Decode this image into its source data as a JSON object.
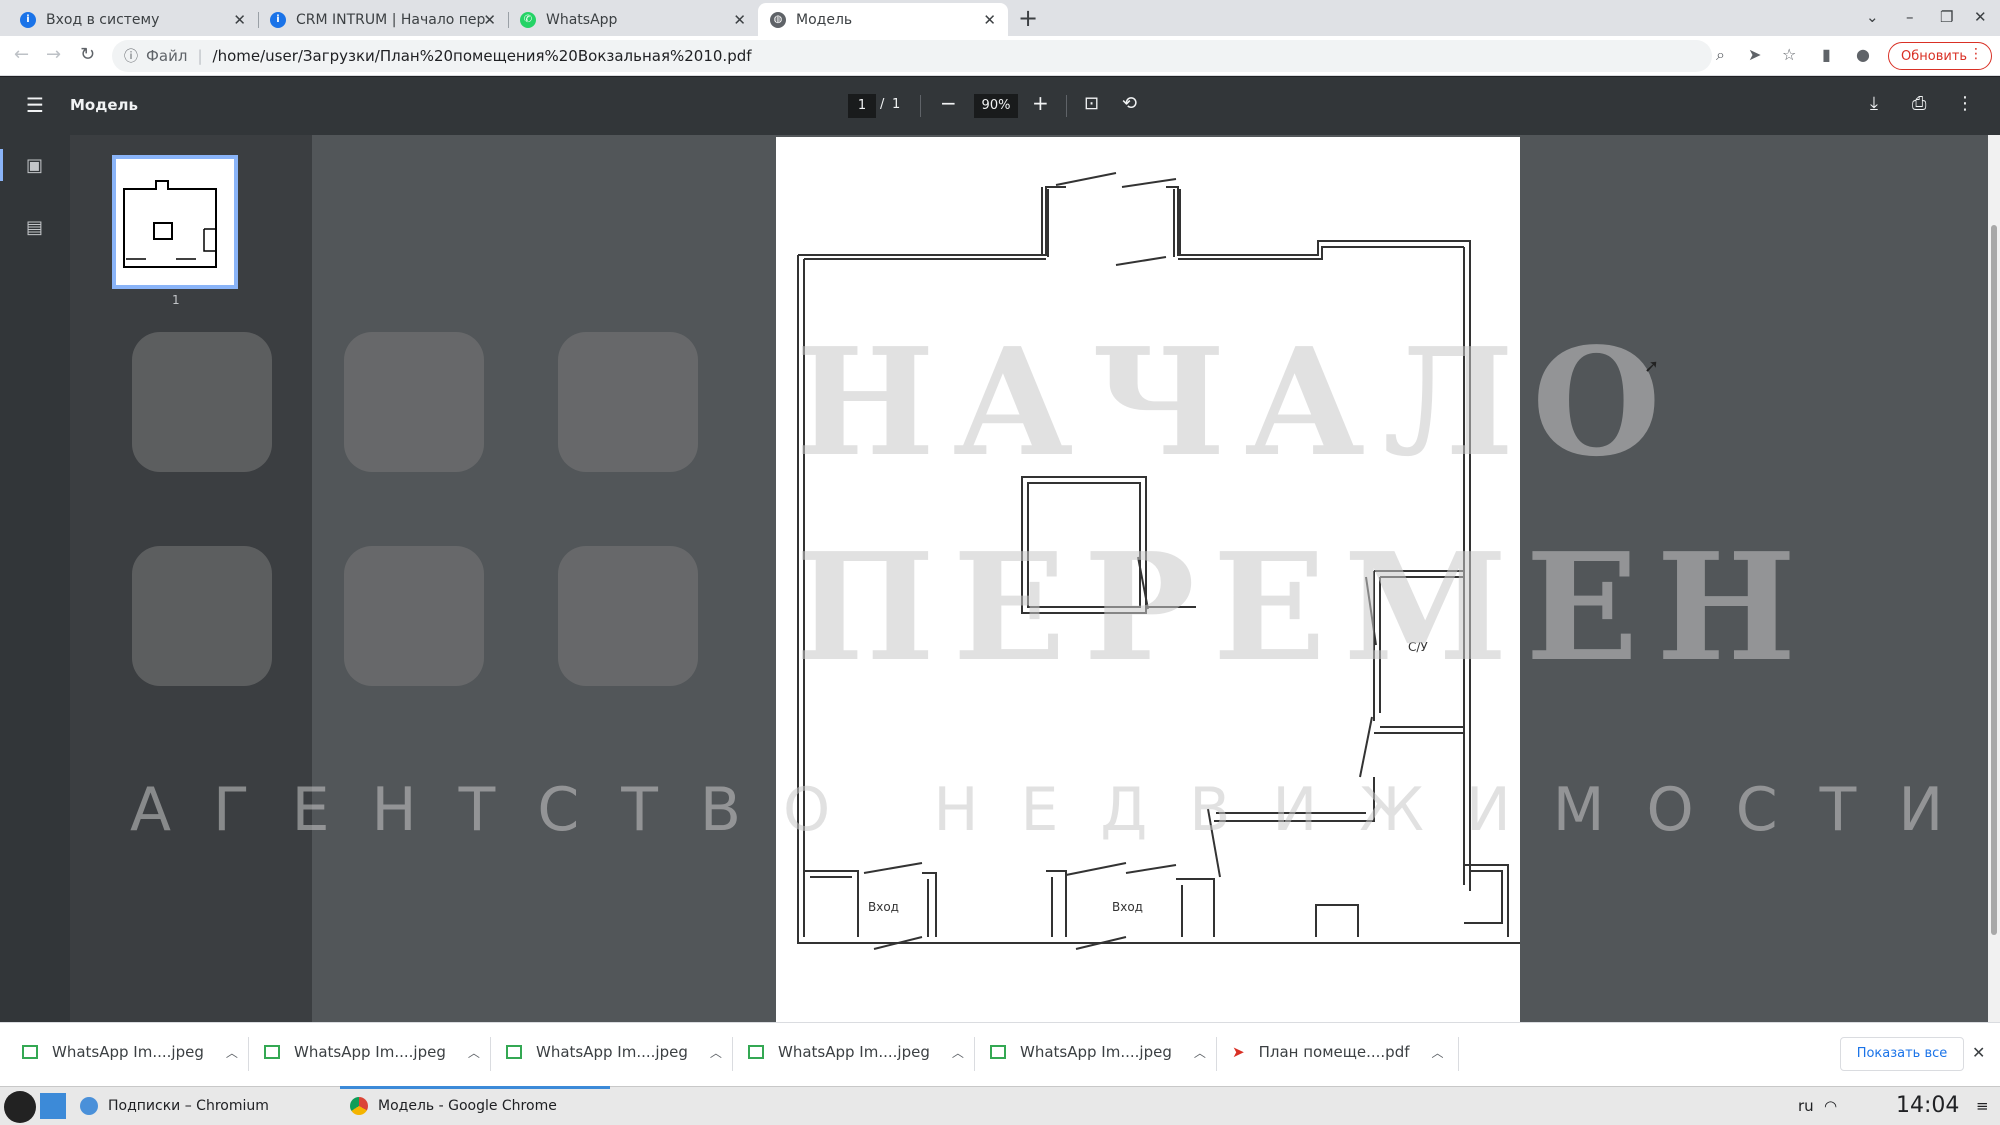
{
  "tabs": [
    {
      "title": "Вход в систему",
      "icon": "intrum-icon"
    },
    {
      "title": "CRM INTRUM | Начало пере",
      "icon": "intrum-icon"
    },
    {
      "title": "WhatsApp",
      "icon": "whatsapp-icon"
    },
    {
      "title": "Модель",
      "icon": "globe-icon"
    }
  ],
  "address": {
    "scheme_label": "Файл",
    "url": "/home/user/Загрузки/План%20помещения%20Вокзальная%2010.pdf"
  },
  "update_button": "Обновить",
  "pdf": {
    "title": "Модель",
    "current_page": "1",
    "page_separator": "/",
    "total_pages": "1",
    "zoom": "90%",
    "thumbnail_label": "1"
  },
  "plan_labels": {
    "room_wc": "С/У",
    "entrance_1": "Вход",
    "entrance_2": "Вход"
  },
  "watermark": {
    "line1": "НАЧАЛО",
    "line2": "ПЕРЕМЕН",
    "line3": "АГЕНТСТВО НЕДВИЖИМОСТИ"
  },
  "downloads": [
    {
      "name": "WhatsApp Im....jpeg",
      "icon": "image-file-icon"
    },
    {
      "name": "WhatsApp Im....jpeg",
      "icon": "image-file-icon"
    },
    {
      "name": "WhatsApp Im....jpeg",
      "icon": "image-file-icon"
    },
    {
      "name": "WhatsApp Im....jpeg",
      "icon": "image-file-icon"
    },
    {
      "name": "WhatsApp Im....jpeg",
      "icon": "image-file-icon"
    },
    {
      "name": "План помеще....pdf",
      "icon": "pdf-file-icon"
    }
  ],
  "show_all": "Показать все",
  "taskbar": {
    "items": [
      {
        "label": "Подписки – Chromium"
      },
      {
        "label": "Модель - Google Chrome"
      }
    ],
    "lang": "ru",
    "time": "14:04"
  },
  "colors": {
    "accent": "#1a73e8",
    "update_red": "#d93025",
    "pdf_toolbar": "#323639",
    "viewer_bg": "#525659"
  }
}
